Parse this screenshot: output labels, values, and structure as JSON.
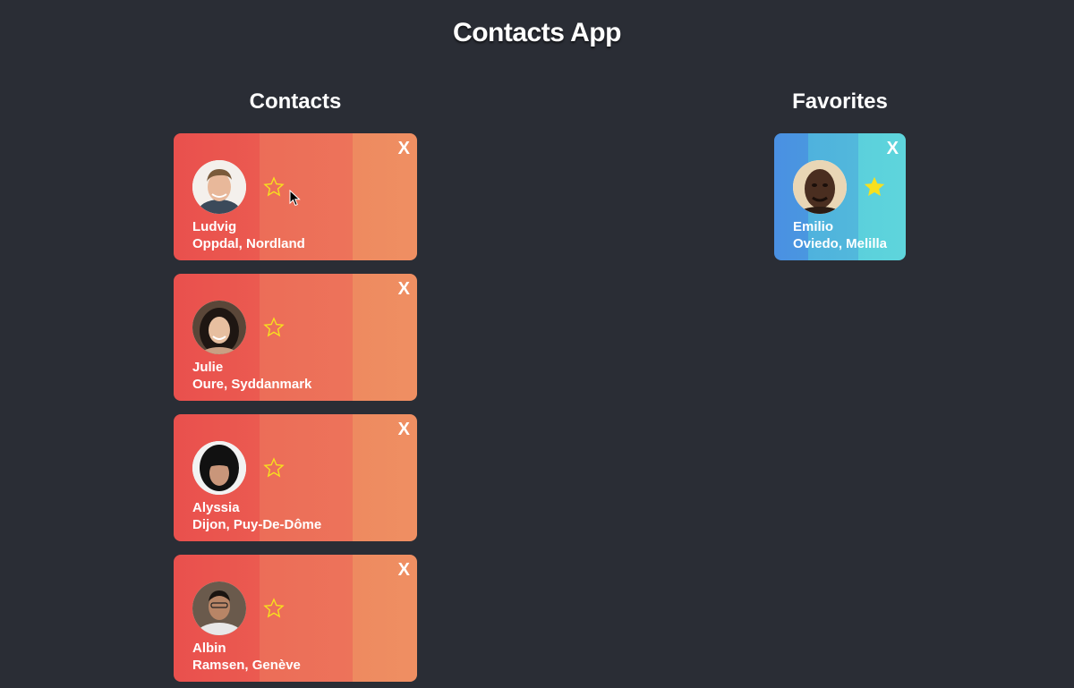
{
  "app": {
    "title": "Contacts App"
  },
  "contacts": {
    "heading": "Contacts",
    "close_label": "X",
    "items": [
      {
        "name": "Ludvig",
        "location": "Oppdal, Nordland"
      },
      {
        "name": "Julie",
        "location": "Oure, Syddanmark"
      },
      {
        "name": "Alyssia",
        "location": "Dijon, Puy-De-Dôme"
      },
      {
        "name": "Albin",
        "location": "Ramsen, Genève"
      }
    ]
  },
  "favorites": {
    "heading": "Favorites",
    "close_label": "X",
    "items": [
      {
        "name": "Emilio",
        "location": "Oviedo, Melilla"
      }
    ]
  },
  "colors": {
    "background": "#2a2d35",
    "contact_card_accent": "#e9504d",
    "favorite_card_accent": "#4a90e2",
    "star": "#f7e01e"
  },
  "icons": {
    "close": "close-icon",
    "star_outline": "star-outline-icon",
    "star_filled": "star-filled-icon",
    "cursor": "cursor-icon"
  }
}
